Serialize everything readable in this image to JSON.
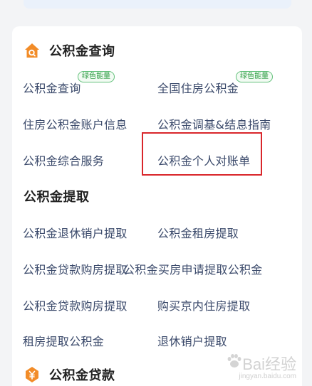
{
  "sections": [
    {
      "title": "公积金查询",
      "icon": "search-house-icon",
      "items": [
        {
          "label": "公积金查询",
          "badge": "绿色能量"
        },
        {
          "label": "全国住房公积金",
          "badge": "绿色能量"
        },
        {
          "label": "住房公积金账户信息"
        },
        {
          "label": "公积金调基&结息指南"
        },
        {
          "label": "公积金综合服务"
        },
        {
          "label": "公积金个人对账单"
        }
      ]
    },
    {
      "title": "公积金提取",
      "items": [
        {
          "label": "公积金退休销户提取"
        },
        {
          "label": "公积金租房提取"
        },
        {
          "label": "公积金贷款购房提取"
        },
        {
          "label": "公积金买房申请提取公积金"
        },
        {
          "label": "公积金贷款购房提取"
        },
        {
          "label": "购买京内住房提取"
        },
        {
          "label": "租房提取公积金"
        },
        {
          "label": "退休销户提取"
        }
      ]
    },
    {
      "title": "公积金贷款",
      "icon": "yuan-coin-icon"
    }
  ],
  "watermark": {
    "main": "Bai经验",
    "sub": "jingyan.baidu.com"
  },
  "colors": {
    "accent": "#f28c28",
    "link": "#3b4a6b",
    "badge": "#2f9e44",
    "highlight": "#d9262b"
  }
}
